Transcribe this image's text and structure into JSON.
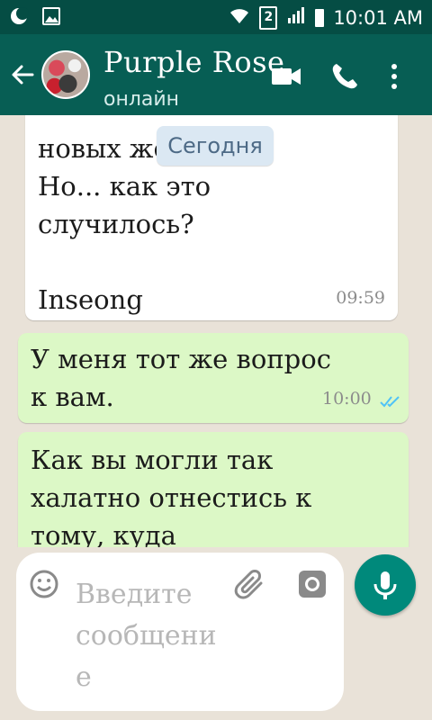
{
  "status_bar": {
    "sim_number": "2",
    "time": "10:01 AM"
  },
  "header": {
    "contact_name": "Purple Rose",
    "contact_status": "онлайн"
  },
  "chat": {
    "date_chip": "Сегодня",
    "messages": [
      {
        "direction": "incoming",
        "text": "новых же\nНо... как это\nслучилось?\n\nInseong",
        "time": "09:59"
      },
      {
        "direction": "outgoing",
        "text": "У меня тот же вопрос\nк вам.",
        "time": "10:00",
        "status": "read"
      },
      {
        "direction": "outgoing",
        "text": "Как вы могли так\nхалатно отнестись к\nтому, куда"
      }
    ]
  },
  "composer": {
    "placeholder": "Введите\nсообщени\nе"
  },
  "colors": {
    "header": "#075e54",
    "status_bar": "#054d44",
    "outgoing_bubble": "#dcf8c6",
    "incoming_bubble": "#ffffff",
    "accent": "#00897b",
    "read_ticks": "#4fc3f7"
  }
}
